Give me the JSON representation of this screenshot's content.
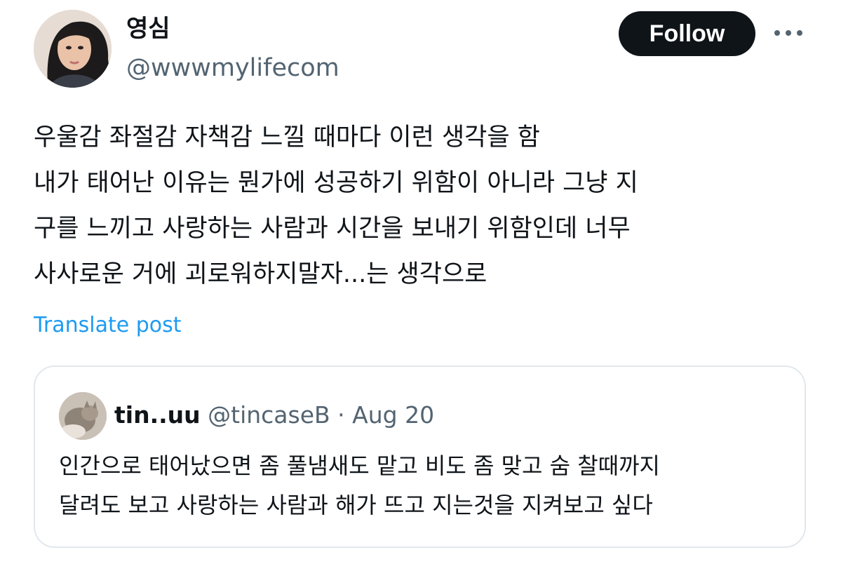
{
  "author": {
    "display_name": "영심",
    "handle": "@wwwmylifecom"
  },
  "actions": {
    "follow_label": "Follow",
    "more_icon": "more-horizontal-icon"
  },
  "post": {
    "lines": [
      "우울감 좌절감 자책감 느낄 때마다 이런 생각을 함",
      "내가 태어난 이유는 뭔가에 성공하기 위함이 아니라 그냥 지",
      "구를 느끼고 사랑하는 사람과 시간을 보내기 위함인데 너무",
      "사사로운 거에 괴로워하지말자...는 생각으로"
    ],
    "translate_label": "Translate post"
  },
  "quote": {
    "name": "tin..uu",
    "handle": "@tincaseB",
    "separator": "·",
    "date": "Aug 20",
    "lines": [
      "인간으로 태어났으면 좀 풀냄새도 맡고 비도 좀 맞고 숨 찰때까지",
      "달려도 보고 사랑하는 사람과 해가 뜨고 지는것을 지켜보고 싶다"
    ]
  },
  "colors": {
    "text": "#0f1419",
    "secondary": "#536471",
    "link": "#1d9bf0",
    "border": "#e1e8ed",
    "button_bg": "#0f1419",
    "button_text": "#ffffff"
  }
}
